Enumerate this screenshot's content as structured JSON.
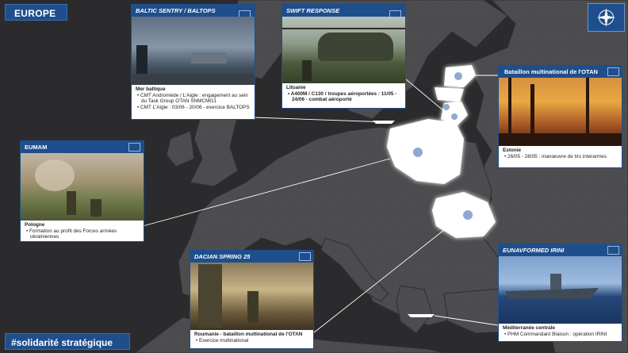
{
  "header": {
    "region": "EUROPE",
    "hashtag": "#solidarité stratégique"
  },
  "badges": {
    "nato_icon": "nato-compass-icon",
    "eu_icon": "eu-flag-icon"
  },
  "colors": {
    "navy": "#1f4e8c",
    "map_bg": "#2b2b2d",
    "land": "#4a4a4c",
    "highlight": "#ffffff"
  },
  "cards": {
    "baltic": {
      "title": "BALTIC SENTRY / BALTOPS",
      "location": "Mer baltique",
      "lines": [
        "CMT Andromède / L'Aigle : engagement au sein du Task Group OTAN SNMCMG1",
        "CMT L'Aigle : 03/06 - 20/06 - exercice BALTOPS"
      ]
    },
    "swift": {
      "title": "SWIFT RESPONSE",
      "location": "Lituanie",
      "lines": [
        "A400M / C130 / troupes aéroportées : 11/05 - 24/06 - combat aéroporté"
      ]
    },
    "estonia": {
      "title": "Bataillon multinational de l'OTAN",
      "location": "Estonie",
      "lines": [
        "26/05 - 28/05 : manœuvre de tirs interarmes"
      ]
    },
    "eumam": {
      "title": "EUMAM",
      "location": "Pologne",
      "lines": [
        "Formation au profit des Forces armées ukrainiennes"
      ]
    },
    "dacian": {
      "title": "DACIAN SPRING 25",
      "location": "Roumanie - bataillon multinational de l'OTAN",
      "lines": [
        "Exercice multinational"
      ]
    },
    "irini": {
      "title": "EUNAVFORMED IRINI",
      "location": "Méditerranée centrale",
      "lines": [
        "PHM Commandant Blaison : opération IRINI"
      ]
    }
  }
}
